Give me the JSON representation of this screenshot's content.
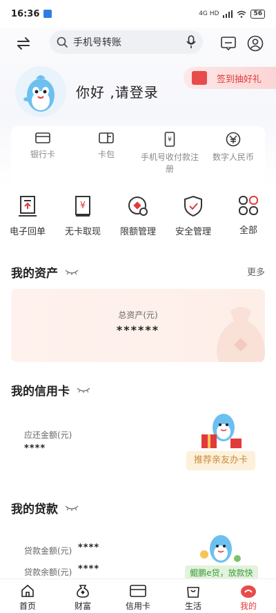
{
  "status_bar": {
    "time": "16:36",
    "signal": "4G HD",
    "battery": "56"
  },
  "search": {
    "placeholder": "手机号转账"
  },
  "profile": {
    "greeting": "你好 ,请登录"
  },
  "checkin": {
    "label": "签到抽好礼"
  },
  "quick_actions": [
    {
      "label": "银行卡",
      "icon": "card-icon"
    },
    {
      "label": "卡包",
      "icon": "wallet-icon"
    },
    {
      "label": "手机号收付款注册",
      "icon": "phone-pay-icon"
    },
    {
      "label": "数字人民币",
      "icon": "digital-rmb-icon"
    }
  ],
  "services": [
    {
      "label": "电子回单",
      "icon": "receipt-icon"
    },
    {
      "label": "无卡取现",
      "icon": "cash-icon"
    },
    {
      "label": "限额管理",
      "icon": "limit-icon"
    },
    {
      "label": "安全管理",
      "icon": "shield-icon"
    },
    {
      "label": "全部",
      "icon": "grid-icon"
    }
  ],
  "assets": {
    "title": "我的资产",
    "more": "更多",
    "total_label": "总资产(元)",
    "total_value": "******"
  },
  "credit": {
    "title": "我的信用卡",
    "due_label": "应还金额(元)",
    "due_value": "****",
    "promo": "推荐亲友办卡"
  },
  "loan": {
    "title": "我的贷款",
    "amount_label": "贷款金额(元)",
    "amount_value": "****",
    "balance_label": "贷款余额(元)",
    "balance_value": "****",
    "promo": "鲲鹏e贷，放款快"
  },
  "tabs": [
    {
      "label": "首页",
      "icon": "home-icon"
    },
    {
      "label": "财富",
      "icon": "wealth-icon"
    },
    {
      "label": "信用卡",
      "icon": "credit-card-icon"
    },
    {
      "label": "生活",
      "icon": "bag-icon"
    },
    {
      "label": "我的",
      "icon": "mine-icon",
      "active": true
    }
  ],
  "colors": {
    "accent": "#e23a3a",
    "mascot": "#5bb6ec"
  }
}
